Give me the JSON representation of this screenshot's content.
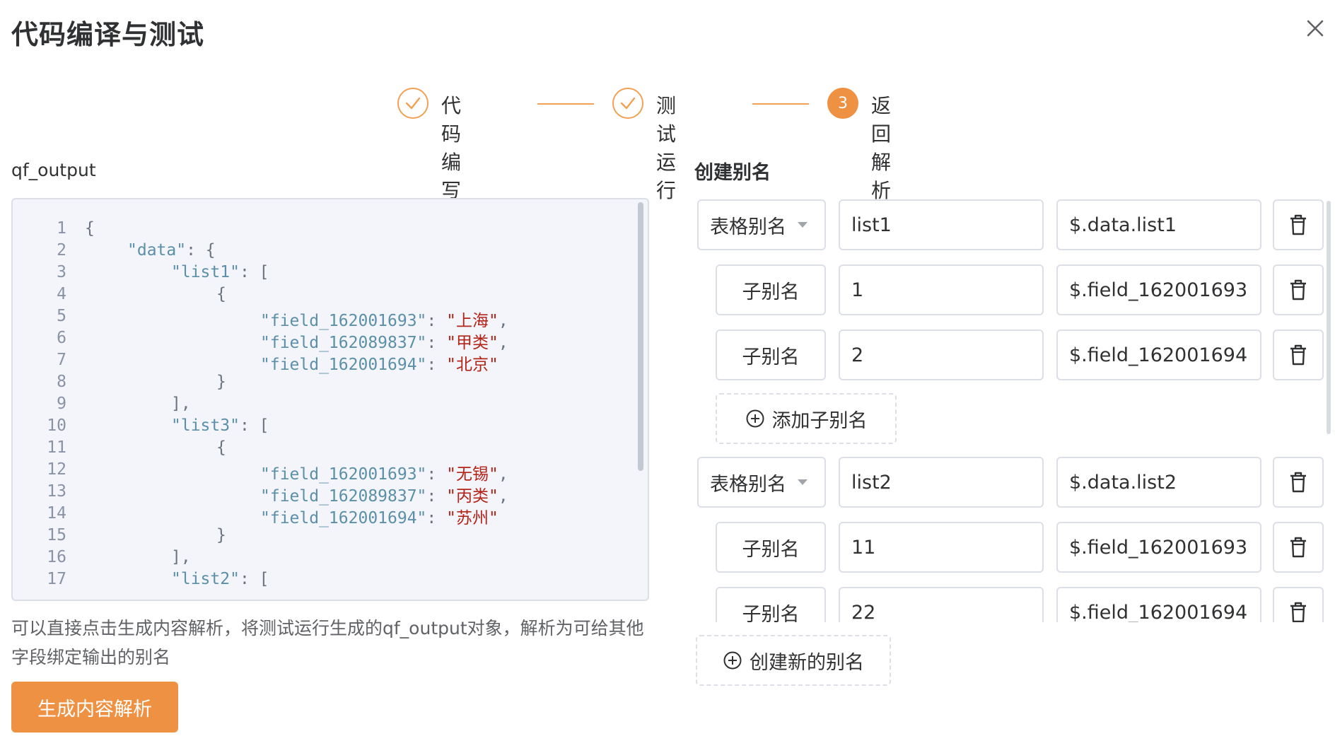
{
  "dialog": {
    "title": "代码编译与测试"
  },
  "steps": [
    {
      "label": "代码编写",
      "status": "done"
    },
    {
      "label": "测试运行",
      "status": "done"
    },
    {
      "label": "返回解析",
      "status": "active",
      "number": "3"
    }
  ],
  "output": {
    "label": "qf_output",
    "lines": [
      {
        "no": "1"
      },
      {
        "no": "2"
      },
      {
        "no": "3"
      },
      {
        "no": "4"
      },
      {
        "no": "5"
      },
      {
        "no": "6"
      },
      {
        "no": "7"
      },
      {
        "no": "8"
      },
      {
        "no": "9"
      },
      {
        "no": "10"
      },
      {
        "no": "11"
      },
      {
        "no": "12"
      },
      {
        "no": "13"
      },
      {
        "no": "14"
      },
      {
        "no": "15"
      },
      {
        "no": "16"
      },
      {
        "no": "17"
      }
    ],
    "tokens": {
      "data_key": "\"data\"",
      "list1_key": "\"list1\"",
      "list3_key": "\"list3\"",
      "list2_key": "\"list2\"",
      "f1": "\"field_162001693\"",
      "f2": "\"field_162089837\"",
      "f3": "\"field_162001694\"",
      "v_shanghai": "\"上海\"",
      "v_jia": "\"甲类\"",
      "v_beijing": "\"北京\"",
      "v_wuxi": "\"无锡\"",
      "v_bing": "\"丙类\"",
      "v_suzhou": "\"苏州\"",
      "open_brace": "{",
      "close_brace": "}",
      "open_bracket": "[",
      "close_list": "],",
      "colon": ":",
      "colon_brace": ": {",
      "colon_bracket": ": [",
      "comma": ","
    },
    "hint": "可以直接点击生成内容解析，将测试运行生成的qf_output对象，解析为可给其他字段绑定输出的别名",
    "generate_label": "生成内容解析"
  },
  "aliases": {
    "title": "创建别名",
    "table_alias_label": "表格别名",
    "sub_alias_label": "子别名",
    "add_sub_label": "添加子别名",
    "create_label": "创建新的别名",
    "groups": [
      {
        "name": "list1",
        "path": "$.data.list1",
        "subs": [
          {
            "name": "1",
            "path": "$.field_162001693"
          },
          {
            "name": "2",
            "path": "$.field_162001694"
          }
        ]
      },
      {
        "name": "list2",
        "path": "$.data.list2",
        "subs": [
          {
            "name": "11",
            "path": "$.field_162001693"
          },
          {
            "name": "22",
            "path": "$.field_162001694"
          }
        ]
      }
    ]
  },
  "colors": {
    "accent": "#ee9143",
    "string": "#b42318",
    "key": "#5c8fa8"
  }
}
